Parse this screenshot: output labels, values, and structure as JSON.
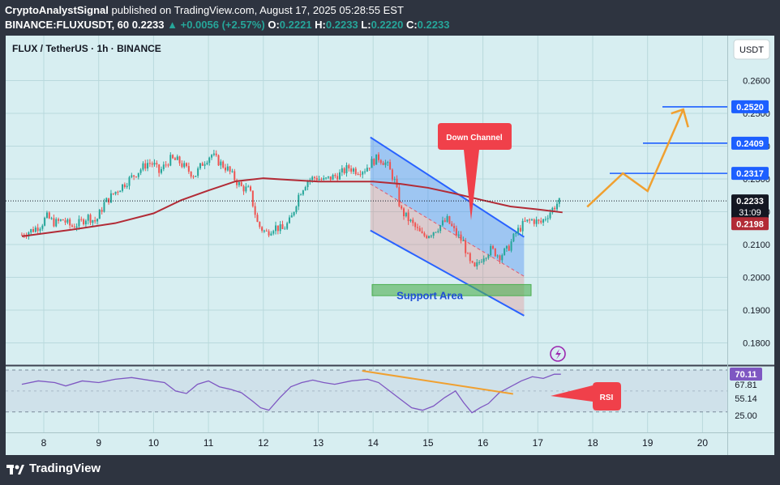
{
  "header": {
    "publisher": "CryptoAnalystSignal",
    "published_text": "published on TradingView.com, August 17, 2025 05:28:55 EST",
    "symbol_line": "BINANCE:FLUXUSDT, 60",
    "last": "0.2233",
    "change": "▲ +0.0056 (+2.57%)",
    "o_label": "O:",
    "o_val": "0.2221",
    "h_label": "H:",
    "h_val": "0.2233",
    "l_label": "L:",
    "l_val": "0.2220",
    "c_label": "C:",
    "c_val": "0.2233"
  },
  "legend": {
    "title": "FLUX / TetherUS · 1h · BINANCE",
    "currency": "USDT"
  },
  "annotations": {
    "down_channel": "Down Channel",
    "support_area": "Support Area",
    "rsi_label": "RSI"
  },
  "colors": {
    "up": "#26a69a",
    "down": "#ef5350",
    "ma": "#b22b36",
    "rsi": "#7e57c2",
    "arrow": "#f0a030",
    "target": "#1c5fff"
  },
  "footer": {
    "brand": "TradingView"
  },
  "chart_data": {
    "type": "candlestick",
    "title": "FLUX / TetherUS · 1h · BINANCE",
    "ylim": [
      0.175,
      0.2625
    ],
    "y_ticks": [
      "0.2600",
      "0.2500",
      "0.2400",
      "0.2300",
      "0.2200",
      "0.2100",
      "0.2000",
      "0.1900",
      "0.1800"
    ],
    "x_ticks": [
      "8",
      "9",
      "10",
      "11",
      "12",
      "13",
      "14",
      "15",
      "16",
      "17",
      "18",
      "19",
      "20"
    ],
    "close_path": [
      [
        7.6,
        0.213
      ],
      [
        7.8,
        0.2145
      ],
      [
        7.95,
        0.216
      ],
      [
        8.05,
        0.2185
      ],
      [
        8.2,
        0.2165
      ],
      [
        8.35,
        0.2175
      ],
      [
        8.5,
        0.2155
      ],
      [
        8.65,
        0.2165
      ],
      [
        8.8,
        0.2185
      ],
      [
        8.95,
        0.217
      ],
      [
        9.1,
        0.2225
      ],
      [
        9.3,
        0.226
      ],
      [
        9.5,
        0.229
      ],
      [
        9.7,
        0.232
      ],
      [
        9.9,
        0.235
      ],
      [
        10.0,
        0.2345
      ],
      [
        10.1,
        0.232
      ],
      [
        10.3,
        0.236
      ],
      [
        10.45,
        0.2355
      ],
      [
        10.6,
        0.233
      ],
      [
        10.75,
        0.231
      ],
      [
        10.9,
        0.235
      ],
      [
        11.05,
        0.2375
      ],
      [
        11.2,
        0.235
      ],
      [
        11.35,
        0.233
      ],
      [
        11.5,
        0.2295
      ],
      [
        11.6,
        0.2275
      ],
      [
        11.75,
        0.2265
      ],
      [
        11.9,
        0.216
      ],
      [
        12.05,
        0.2135
      ],
      [
        12.2,
        0.2155
      ],
      [
        12.35,
        0.2145
      ],
      [
        12.5,
        0.2175
      ],
      [
        12.65,
        0.2255
      ],
      [
        12.8,
        0.2295
      ],
      [
        12.95,
        0.2305
      ],
      [
        13.1,
        0.2295
      ],
      [
        13.25,
        0.2305
      ],
      [
        13.4,
        0.2315
      ],
      [
        13.55,
        0.2335
      ],
      [
        13.7,
        0.2325
      ],
      [
        13.85,
        0.233
      ],
      [
        14.0,
        0.2355
      ],
      [
        14.1,
        0.2365
      ],
      [
        14.25,
        0.2345
      ],
      [
        14.4,
        0.229
      ],
      [
        14.5,
        0.2205
      ],
      [
        14.6,
        0.2185
      ],
      [
        14.75,
        0.2155
      ],
      [
        14.9,
        0.2125
      ],
      [
        15.05,
        0.2135
      ],
      [
        15.2,
        0.2155
      ],
      [
        15.35,
        0.2175
      ],
      [
        15.5,
        0.2135
      ],
      [
        15.65,
        0.2105
      ],
      [
        15.75,
        0.2045
      ],
      [
        15.85,
        0.2025
      ],
      [
        16.0,
        0.2065
      ],
      [
        16.15,
        0.2085
      ],
      [
        16.3,
        0.2065
      ],
      [
        16.45,
        0.2085
      ],
      [
        16.6,
        0.2135
      ],
      [
        16.75,
        0.2165
      ],
      [
        16.9,
        0.2175
      ],
      [
        17.05,
        0.2165
      ],
      [
        17.2,
        0.2195
      ],
      [
        17.35,
        0.2225
      ],
      [
        17.42,
        0.2233
      ]
    ],
    "ma_path": [
      [
        7.6,
        0.2125
      ],
      [
        8.5,
        0.2145
      ],
      [
        9.3,
        0.2165
      ],
      [
        10.0,
        0.2195
      ],
      [
        10.5,
        0.2235
      ],
      [
        11.0,
        0.2265
      ],
      [
        11.5,
        0.2293
      ],
      [
        12.0,
        0.2302
      ],
      [
        12.5,
        0.2297
      ],
      [
        13.0,
        0.2292
      ],
      [
        13.5,
        0.2292
      ],
      [
        14.0,
        0.2292
      ],
      [
        14.5,
        0.2285
      ],
      [
        15.0,
        0.2273
      ],
      [
        15.5,
        0.2255
      ],
      [
        16.0,
        0.2235
      ],
      [
        16.5,
        0.2216
      ],
      [
        17.0,
        0.2207
      ],
      [
        17.45,
        0.2198
      ]
    ],
    "last_price": 0.2233,
    "ma_value": 0.2198,
    "countdown": "31:09",
    "targets": [
      0.2317,
      0.2409,
      0.252
    ],
    "channel": {
      "upper": [
        [
          13.95,
          0.2427
        ],
        [
          16.75,
          0.2123
        ]
      ],
      "lower": [
        [
          13.95,
          0.2143
        ],
        [
          16.75,
          0.1883
        ]
      ]
    },
    "support_area": [
      0.1978,
      0.1944
    ],
    "projection": [
      [
        17.9,
        0.2215
      ],
      [
        18.55,
        0.2317
      ],
      [
        19.0,
        0.2263
      ],
      [
        19.65,
        0.2512
      ]
    ],
    "rsi": {
      "levels": [
        75,
        25
      ],
      "tick_labels": [
        "70.11",
        "67.81",
        "55.14",
        "25.00"
      ],
      "value": 70.11,
      "path": [
        [
          7.6,
          58
        ],
        [
          7.9,
          62
        ],
        [
          8.2,
          60
        ],
        [
          8.4,
          56
        ],
        [
          8.7,
          62
        ],
        [
          9.0,
          60
        ],
        [
          9.3,
          64
        ],
        [
          9.6,
          66
        ],
        [
          9.9,
          63
        ],
        [
          10.2,
          60
        ],
        [
          10.4,
          50
        ],
        [
          10.6,
          47
        ],
        [
          10.8,
          58
        ],
        [
          11.0,
          62
        ],
        [
          11.2,
          55
        ],
        [
          11.4,
          52
        ],
        [
          11.6,
          48
        ],
        [
          11.8,
          38
        ],
        [
          11.95,
          30
        ],
        [
          12.1,
          27
        ],
        [
          12.3,
          42
        ],
        [
          12.5,
          55
        ],
        [
          12.7,
          60
        ],
        [
          12.9,
          63
        ],
        [
          13.1,
          60
        ],
        [
          13.3,
          58
        ],
        [
          13.6,
          62
        ],
        [
          13.9,
          64
        ],
        [
          14.1,
          60
        ],
        [
          14.3,
          50
        ],
        [
          14.5,
          40
        ],
        [
          14.7,
          30
        ],
        [
          14.9,
          27
        ],
        [
          15.1,
          32
        ],
        [
          15.3,
          42
        ],
        [
          15.5,
          50
        ],
        [
          15.65,
          36
        ],
        [
          15.8,
          24
        ],
        [
          15.95,
          30
        ],
        [
          16.1,
          35
        ],
        [
          16.3,
          48
        ],
        [
          16.5,
          55
        ],
        [
          16.7,
          62
        ],
        [
          16.9,
          67
        ],
        [
          17.1,
          65
        ],
        [
          17.3,
          70
        ],
        [
          17.42,
          70
        ]
      ],
      "trendline": [
        [
          13.8,
          74
        ],
        [
          16.55,
          46.5
        ]
      ]
    }
  }
}
